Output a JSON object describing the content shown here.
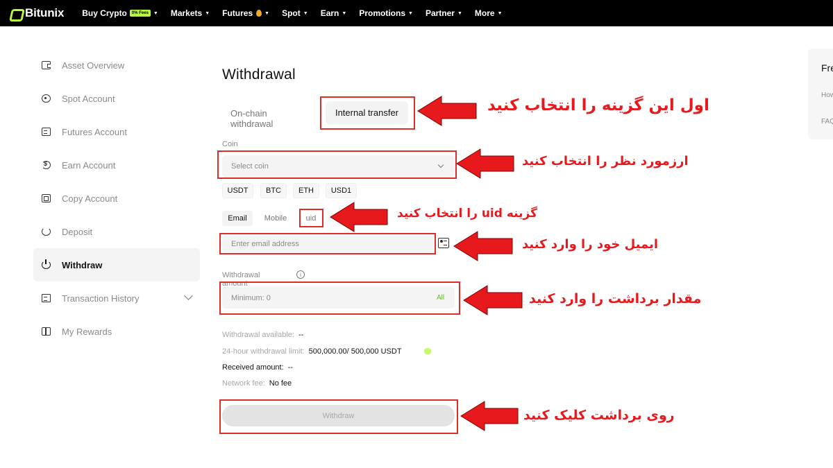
{
  "brand": {
    "name": "Bitunix",
    "accent": "#b9f641"
  },
  "nav": {
    "items": [
      {
        "label": "Buy Crypto",
        "badge": "0% Fees"
      },
      {
        "label": "Markets"
      },
      {
        "label": "Futures"
      },
      {
        "label": "Spot"
      },
      {
        "label": "Earn"
      },
      {
        "label": "Promotions"
      },
      {
        "label": "Partner"
      },
      {
        "label": "More"
      }
    ]
  },
  "sidebar": {
    "items": [
      {
        "label": "Asset Overview",
        "icon": "wallet-icon"
      },
      {
        "label": "Spot Account",
        "icon": "target-icon"
      },
      {
        "label": "Futures Account",
        "icon": "document-icon"
      },
      {
        "label": "Earn Account",
        "icon": "coin-icon"
      },
      {
        "label": "Copy Account",
        "icon": "copy-icon"
      },
      {
        "label": "Deposit",
        "icon": "deposit-icon"
      },
      {
        "label": "Withdraw",
        "icon": "withdraw-icon",
        "active": true
      },
      {
        "label": "Transaction History",
        "icon": "history-icon"
      },
      {
        "label": "My Rewards",
        "icon": "reward-icon"
      }
    ]
  },
  "withdrawal": {
    "title": "Withdrawal",
    "tabs": {
      "onchain": "On-chain withdrawal",
      "internal": "Internal transfer"
    },
    "coin_label": "Coin",
    "coin_placeholder": "Select coin",
    "coin_chips": [
      "USDT",
      "BTC",
      "ETH",
      "USD1"
    ],
    "account_tabs": {
      "email": "Email",
      "mobile": "Mobile",
      "uid": "uid"
    },
    "email_placeholder": "Enter email address",
    "amount_label": "Withdrawal amount",
    "amount_placeholder": "Minimum: 0",
    "all_label": "All",
    "available_label": "Withdrawal available:",
    "available_value": "--",
    "limit_label": "24-hour withdrawal limit:",
    "limit_value": "500,000.00/ 500,000 USDT",
    "received_label": "Received amount:",
    "received_value": "--",
    "fee_label": "Network fee:",
    "fee_value": "No fee",
    "submit_label": "Withdraw"
  },
  "right_panel": {
    "title": "Fre",
    "lines": [
      "How",
      "FAQ"
    ]
  },
  "annotations": {
    "color": "#e12b2b",
    "notes": [
      "اول این گزینه را انتخاب کنید",
      "ارزمورد نظر را انتخاب کنید",
      "گزینه uid را انتخاب کنید",
      "ایمیل خود را وارد کنید",
      "مقدار برداشت را وارد کنید",
      "روی برداشت کلیک کنید"
    ]
  }
}
